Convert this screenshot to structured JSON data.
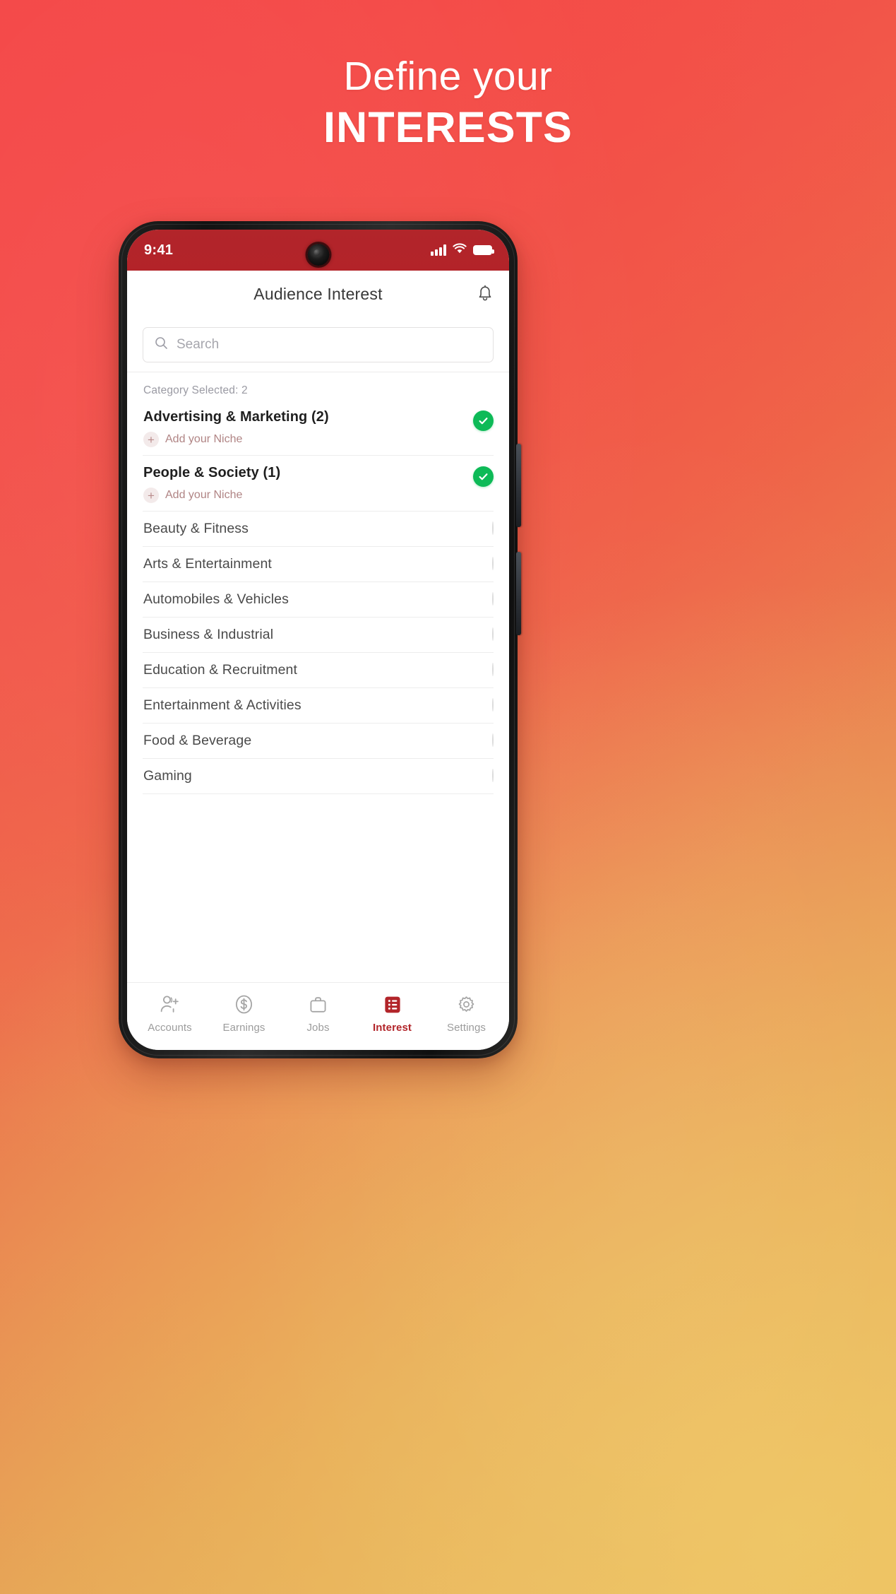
{
  "promo": {
    "line1": "Define your",
    "line2": "INTERESTS"
  },
  "theme": {
    "bg_start": "#F44A48",
    "bg_end": "#E6B75F",
    "brand_red": "#B2252A",
    "accent_green": "#0DBA57",
    "niche_rose": "#B08484"
  },
  "phone": {
    "status_bar": {
      "time": "9:41",
      "signal_icon": "cellular-signal-icon",
      "wifi_icon": "wifi-icon",
      "battery_icon": "battery-icon",
      "camera_icon": "front-camera-icon"
    },
    "app_bar": {
      "title": "Audience Interest",
      "notification_icon": "bell-icon"
    },
    "search": {
      "placeholder": "Search",
      "icon": "search-icon",
      "value": ""
    },
    "list": {
      "count_label": "Category Selected: 2",
      "niche_label": "Add your Niche",
      "items": [
        {
          "label": "Advertising & Marketing (2)",
          "selected": true,
          "has_niche": true
        },
        {
          "label": "People & Society (1)",
          "selected": true,
          "has_niche": true
        },
        {
          "label": "Beauty & Fitness",
          "selected": false,
          "has_niche": false
        },
        {
          "label": "Arts & Entertainment",
          "selected": false,
          "has_niche": false
        },
        {
          "label": "Automobiles & Vehicles",
          "selected": false,
          "has_niche": false
        },
        {
          "label": "Business & Industrial",
          "selected": false,
          "has_niche": false
        },
        {
          "label": "Education & Recruitment",
          "selected": false,
          "has_niche": false
        },
        {
          "label": "Entertainment & Activities",
          "selected": false,
          "has_niche": false
        },
        {
          "label": "Food & Beverage",
          "selected": false,
          "has_niche": false
        },
        {
          "label": "Gaming",
          "selected": false,
          "has_niche": false
        }
      ]
    },
    "bottom_nav": [
      {
        "label": "Accounts",
        "icon": "add-person-icon",
        "active": false
      },
      {
        "label": "Earnings",
        "icon": "dollar-coin-icon",
        "active": false
      },
      {
        "label": "Jobs",
        "icon": "briefcase-icon",
        "active": false
      },
      {
        "label": "Interest",
        "icon": "list-icon",
        "active": true
      },
      {
        "label": "Settings",
        "icon": "gear-icon",
        "active": false
      }
    ]
  }
}
